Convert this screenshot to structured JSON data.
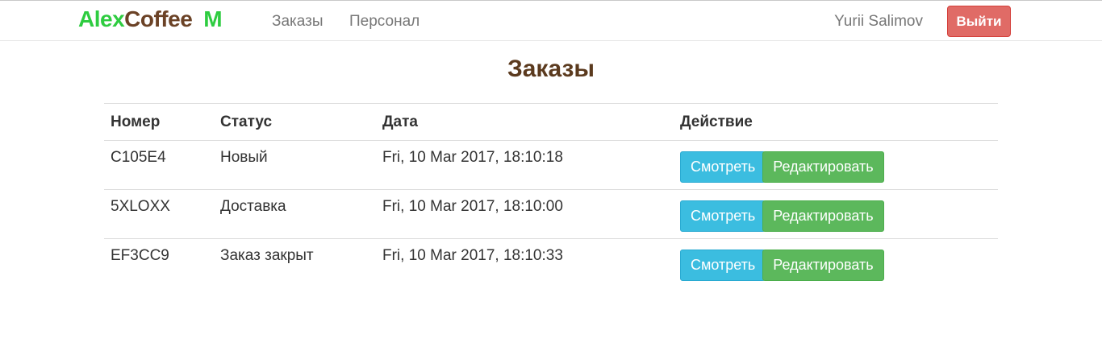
{
  "navbar": {
    "brand": {
      "part1": "Alex",
      "part2": "Coffee",
      "part3": "M"
    },
    "links": [
      {
        "label": "Заказы"
      },
      {
        "label": "Персонал"
      }
    ],
    "user": "Yurii Salimov",
    "logout_label": "Выйти"
  },
  "page": {
    "title": "Заказы"
  },
  "table": {
    "headers": [
      "Номер",
      "Статус",
      "Дата",
      "Действие"
    ],
    "rows": [
      {
        "number": "C105E4",
        "status": "Новый",
        "date": "Fri, 10 Mar 2017, 18:10:18",
        "view_label": "Смотреть",
        "edit_label": "Редактировать"
      },
      {
        "number": "5XLOXX",
        "status": "Доставка",
        "date": "Fri, 10 Mar 2017, 18:10:00",
        "view_label": "Смотреть",
        "edit_label": "Редактировать"
      },
      {
        "number": "EF3CC9",
        "status": "Заказ закрыт",
        "date": "Fri, 10 Mar 2017, 18:10:33",
        "view_label": "Смотреть",
        "edit_label": "Редактировать"
      }
    ]
  },
  "colors": {
    "brand_green": "#2ecc40",
    "brand_brown": "#6b4226",
    "title_brown": "#5b3a1e",
    "view_button": "#3bbde0",
    "edit_button": "#5cb85c",
    "logout_button": "#e06b66",
    "status_new": "#2ecc40"
  }
}
